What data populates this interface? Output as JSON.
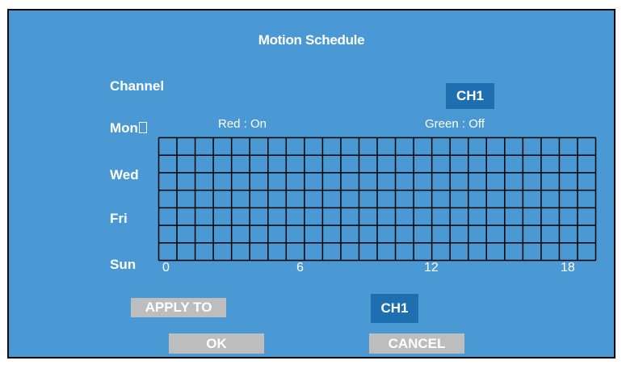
{
  "dialog": {
    "title": "Motion Schedule",
    "channel_label": "Channel",
    "channel_value": "CH1",
    "legend_on": "Red : On",
    "legend_off": "Green : Off"
  },
  "days": {
    "mon": "Mon",
    "wed": "Wed",
    "fri": "Fri",
    "sun": "Sun"
  },
  "hours": [
    "0",
    "6",
    "12",
    "18"
  ],
  "schedule": {
    "rows": 7,
    "columns": 24,
    "active_cells": 0
  },
  "apply": {
    "label": "APPLY TO",
    "value": "CH1"
  },
  "buttons": {
    "ok": "OK",
    "cancel": "CANCEL"
  },
  "colors": {
    "background": "#4a98d4",
    "selected": "#1e6fb0",
    "button": "#bdbdbd",
    "grid_line": "#000000"
  }
}
